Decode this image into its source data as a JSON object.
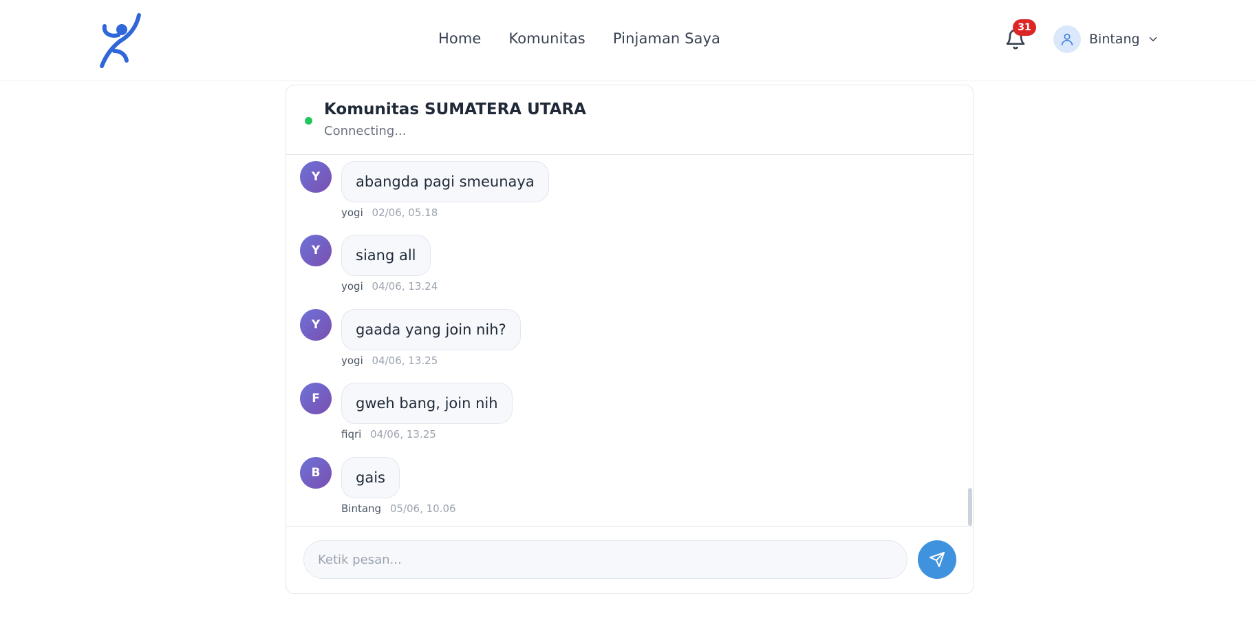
{
  "header": {
    "logo_icon": "person-jumping-logo",
    "nav": [
      {
        "label": "Home"
      },
      {
        "label": "Komunitas"
      },
      {
        "label": "Pinjaman Saya"
      }
    ],
    "notifications": {
      "icon": "bell-icon",
      "count": "31"
    },
    "user": {
      "name": "Bintang",
      "avatar_icon": "user-icon",
      "chevron_icon": "chevron-down-icon"
    }
  },
  "chat": {
    "title": "Komunitas SUMATERA UTARA",
    "status": "Connecting...",
    "status_color": "#22c55e",
    "messages": [
      {
        "initial": "Y",
        "text": "abangda pagi smeunaya",
        "sender": "yogi",
        "time": "02/06, 05.18"
      },
      {
        "initial": "Y",
        "text": "siang all",
        "sender": "yogi",
        "time": "04/06, 13.24"
      },
      {
        "initial": "Y",
        "text": "gaada yang join nih?",
        "sender": "yogi",
        "time": "04/06, 13.25"
      },
      {
        "initial": "F",
        "text": "gweh bang, join nih",
        "sender": "fiqri",
        "time": "04/06, 13.25"
      },
      {
        "initial": "B",
        "text": "gais",
        "sender": "Bintang",
        "time": "05/06, 10.06"
      }
    ],
    "input": {
      "value": "",
      "placeholder": "Ketik pesan..."
    },
    "send_icon": "send-icon"
  },
  "colors": {
    "accent": "#3f93de",
    "badge": "#dc2626",
    "logo": "#2f66d9"
  }
}
